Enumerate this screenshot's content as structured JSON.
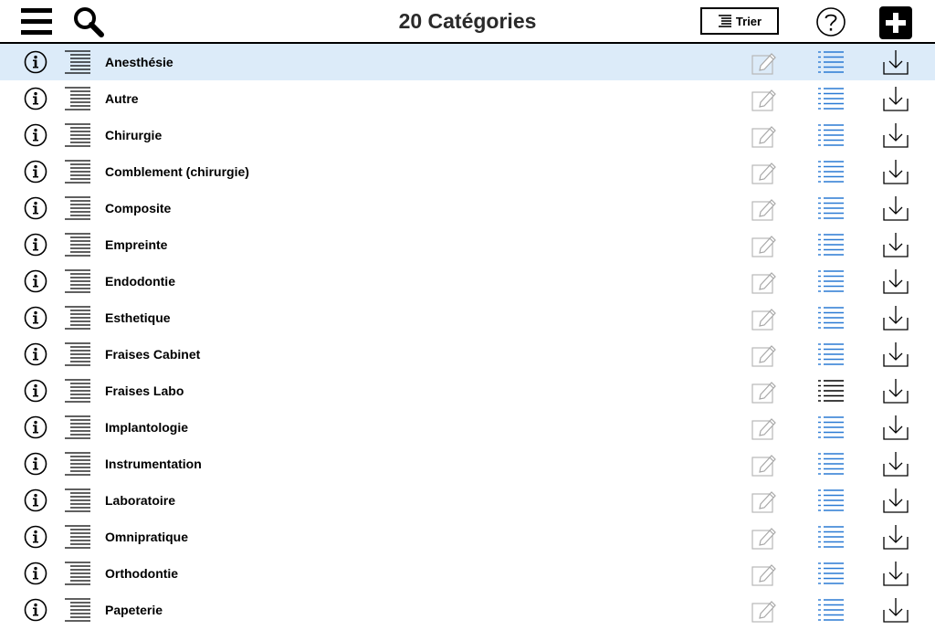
{
  "header": {
    "title": "20 Catégories",
    "sort_label": "Trier"
  },
  "colors": {
    "selected_row": "#dcebf9",
    "list_icon_blue": "#2a7ad4",
    "edit_icon_grey": "#b8b8b8"
  },
  "icons": {
    "menu": "hamburger-menu-icon",
    "search": "magnifier-icon",
    "sort": "sort-lines-icon",
    "help": "question-circle-icon",
    "add": "plus-square-icon",
    "row_info": "info-circle-icon",
    "row_drag": "reorder-lines-icon",
    "row_edit": "pencil-edit-icon",
    "row_list": "bulleted-list-icon",
    "row_download": "download-tray-icon"
  },
  "categories": [
    {
      "label": "Anesthésie",
      "selected": true
    },
    {
      "label": "Autre"
    },
    {
      "label": "Chirurgie"
    },
    {
      "label": "Comblement (chirurgie)"
    },
    {
      "label": "Composite"
    },
    {
      "label": "Empreinte"
    },
    {
      "label": "Endodontie"
    },
    {
      "label": "Esthetique"
    },
    {
      "label": "Fraises Cabinet"
    },
    {
      "label": "Fraises Labo",
      "list_icon_dark": true
    },
    {
      "label": "Implantologie"
    },
    {
      "label": "Instrumentation"
    },
    {
      "label": "Laboratoire"
    },
    {
      "label": "Omnipratique"
    },
    {
      "label": "Orthodontie"
    },
    {
      "label": "Papeterie"
    }
  ]
}
